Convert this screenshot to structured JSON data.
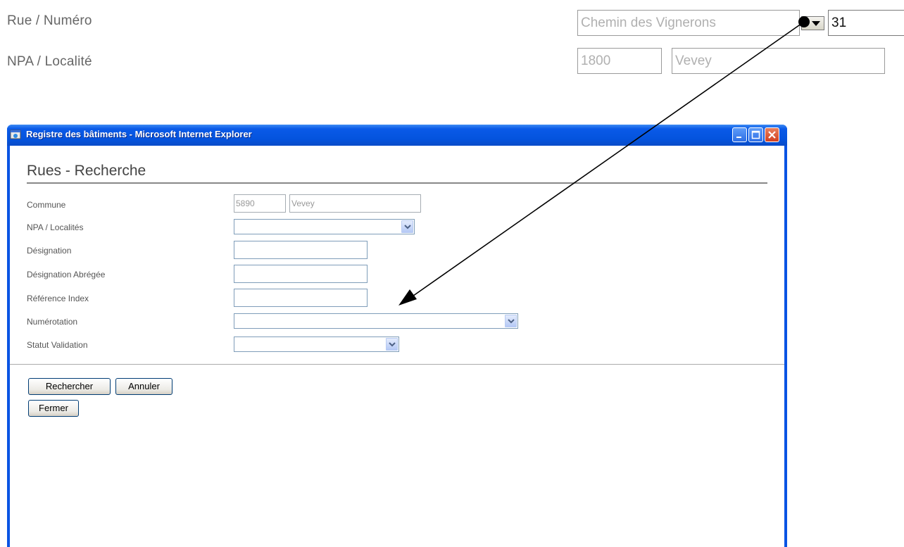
{
  "top_form": {
    "street_label": "Rue / Numéro",
    "street_value": "Chemin des Vignerons",
    "number_value": "31",
    "locality_label": "NPA / Localité",
    "npa_value": "1800",
    "locality_value": "Vevey"
  },
  "window": {
    "title": "Registre des bâtiments - Microsoft Internet Explorer",
    "title_color": "#0a54e3"
  },
  "search_form": {
    "heading": "Rues - Recherche",
    "fields": {
      "commune_label": "Commune",
      "commune_code": "5890",
      "commune_name": "Vevey",
      "npa_label": "NPA / Localités",
      "designation_label": "Désignation",
      "designation_short_label": "Désignation Abrégée",
      "reference_label": "Référence Index",
      "numbering_label": "Numérotation",
      "status_label": "Statut Validation"
    },
    "buttons": {
      "search": "Rechercher",
      "cancel": "Annuler",
      "close": "Fermer"
    }
  }
}
